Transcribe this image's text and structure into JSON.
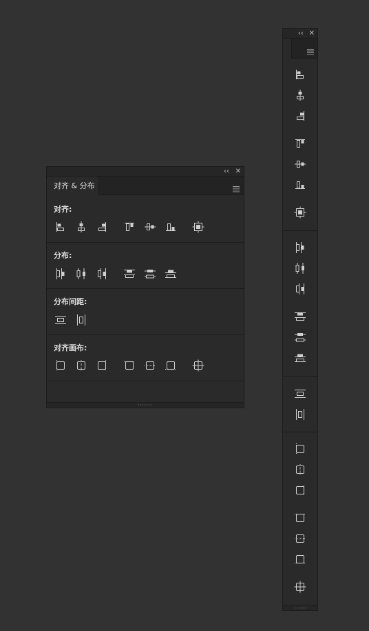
{
  "panel": {
    "collapse_label": "‹‹",
    "close_label": "✕",
    "tab_label": "对齐 & 分布",
    "sections": [
      {
        "label": "对齐:",
        "icons": [
          "align-left-edges-icon",
          "align-horizontal-centers-icon",
          "align-right-edges-icon",
          "align-top-edges-icon",
          "align-vertical-centers-icon",
          "align-bottom-edges-icon",
          "align-centers-icon"
        ]
      },
      {
        "label": "分布:",
        "icons": [
          "distribute-left-edges-icon",
          "distribute-horizontal-centers-icon",
          "distribute-right-edges-icon",
          "distribute-top-edges-icon",
          "distribute-vertical-centers-icon",
          "distribute-bottom-edges-icon"
        ]
      },
      {
        "label": "分布间距:",
        "icons": [
          "distribute-vertical-spacing-icon",
          "distribute-horizontal-spacing-icon"
        ]
      },
      {
        "label": "对齐画布:",
        "icons": [
          "align-canvas-left-icon",
          "align-canvas-horizontal-center-icon",
          "align-canvas-right-icon",
          "align-canvas-top-icon",
          "align-canvas-vertical-center-icon",
          "align-canvas-bottom-icon",
          "align-canvas-center-icon"
        ]
      }
    ]
  },
  "strip": {
    "collapse_label": "‹‹",
    "close_label": "✕"
  }
}
